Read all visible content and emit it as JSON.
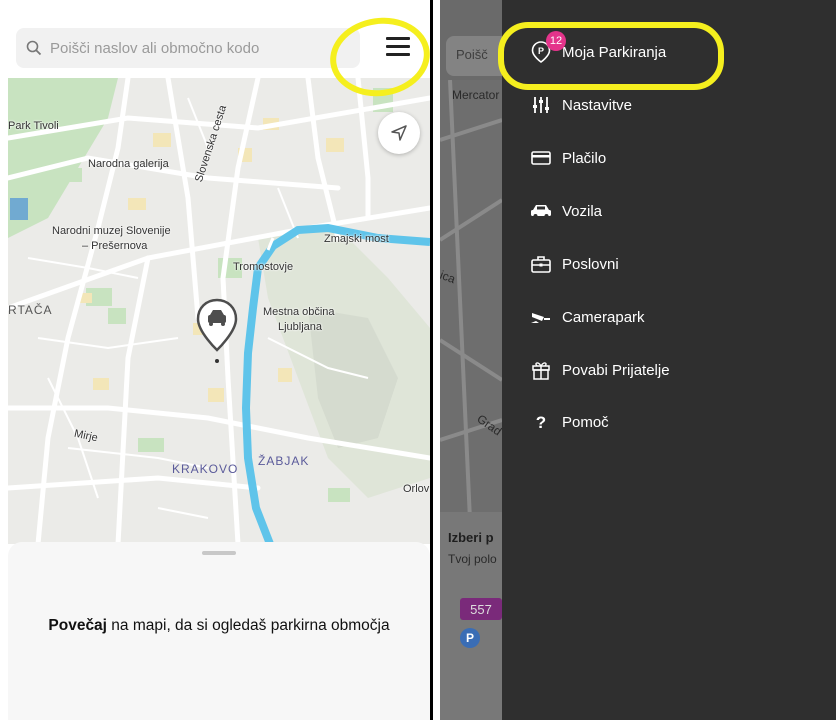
{
  "left_screen": {
    "search": {
      "placeholder": "Poišči naslov ali območno kodo"
    },
    "map_labels": {
      "park_tivoli": "Park Tivoli",
      "narodna_galerija": "Narodna galerija",
      "slovenska_cesta": "Slovenska cesta",
      "narodni_muzej": "Narodni muzej Slovenije",
      "presernova": "– Prešernova",
      "zmajski_most": "Zmajski most",
      "tromostovje": "Tromostovje",
      "rtaca": "RTAČA",
      "mestna_obcina": "Mestna občina",
      "ljubljana": "Ljubljana",
      "mirje": "Mirje",
      "krakovo": "KRAKOVO",
      "zabjak": "ŽABJAK",
      "orlov": "Orlov"
    },
    "sheet": {
      "bold": "Povečaj",
      "rest": " na mapi, da si ogledaš parkirna območja"
    }
  },
  "right_screen": {
    "background": {
      "search_fragment": "Poišč",
      "mercator": "Mercator",
      "ica": "ica",
      "grad": "Grad",
      "izberi": "Izberi p",
      "tvoj_polo": "Tvoj polo",
      "zone_code": "557",
      "p_letter": "P"
    },
    "menu": [
      {
        "label": "Moja Parkiranja",
        "icon": "parking-pin-icon"
      },
      {
        "label": "Nastavitve",
        "icon": "settings-sliders-icon"
      },
      {
        "label": "Plačilo",
        "icon": "credit-card-icon"
      },
      {
        "label": "Vozila",
        "icon": "car-icon"
      },
      {
        "label": "Poslovni",
        "icon": "briefcase-icon"
      },
      {
        "label": "Camerapark",
        "icon": "camera-icon"
      },
      {
        "label": "Povabi Prijatelje",
        "icon": "gift-icon"
      },
      {
        "label": "Pomoč",
        "icon": "help-icon"
      }
    ],
    "badge_count": "12"
  },
  "colors": {
    "highlight": "#f5ef1e",
    "river": "#5fc4ea",
    "badge": "#e4348b",
    "drawer": "#2f2f2f",
    "zone_badge": "#7a2a7a"
  }
}
